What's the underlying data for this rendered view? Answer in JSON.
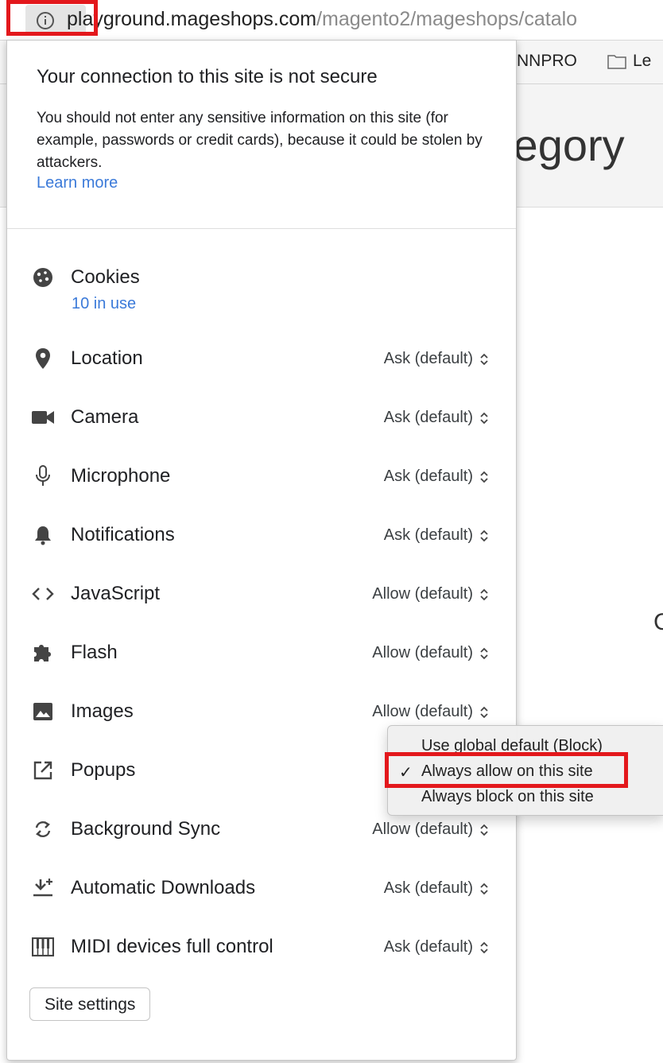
{
  "browser": {
    "url_host": "playground.mageshops.com",
    "url_path": "/magento2/mageshops/catalo",
    "bookmarks": [
      "NNPRO",
      "Le"
    ]
  },
  "page": {
    "title_fragment": "tegory",
    "side_fragment": "C"
  },
  "site_info": {
    "title": "Your connection to this site is not secure",
    "description": "You should not enter any sensitive information on this site (for example, passwords or credit cards), because it could be stolen by attackers.",
    "learn_more": "Learn more",
    "cookies": {
      "label": "Cookies",
      "sub": "10 in use",
      "icon": "cookie-icon"
    },
    "permissions": [
      {
        "label": "Location",
        "value": "Ask (default)",
        "icon": "location-icon"
      },
      {
        "label": "Camera",
        "value": "Ask (default)",
        "icon": "camera-icon"
      },
      {
        "label": "Microphone",
        "value": "Ask (default)",
        "icon": "microphone-icon"
      },
      {
        "label": "Notifications",
        "value": "Ask (default)",
        "icon": "bell-icon"
      },
      {
        "label": "JavaScript",
        "value": "Allow (default)",
        "icon": "code-icon"
      },
      {
        "label": "Flash",
        "value": "Allow (default)",
        "icon": "puzzle-icon"
      },
      {
        "label": "Images",
        "value": "Allow (default)",
        "icon": "image-icon"
      },
      {
        "label": "Popups",
        "value": "",
        "icon": "popup-icon"
      },
      {
        "label": "Background Sync",
        "value": "Allow (default)",
        "icon": "sync-icon"
      },
      {
        "label": "Automatic Downloads",
        "value": "Ask (default)",
        "icon": "download-icon"
      },
      {
        "label": "MIDI devices full control",
        "value": "Ask (default)",
        "icon": "midi-icon"
      }
    ],
    "site_settings": "Site settings"
  },
  "popup_menu": {
    "items": [
      "Use global default (Block)",
      "Always allow on this site",
      "Always block on this site"
    ],
    "selected_index": 1,
    "check": "✓"
  },
  "colors": {
    "annotation": "#e3181c",
    "link": "#3b7ad9"
  }
}
